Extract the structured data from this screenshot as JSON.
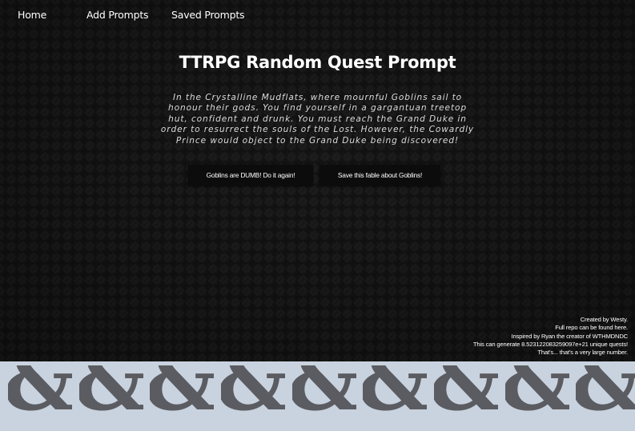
{
  "nav": {
    "home": "Home",
    "add_prompts": "Add Prompts",
    "saved_prompts": "Saved Prompts"
  },
  "title": "TTRPG Random Quest Prompt",
  "quest": "In the Crystalline Mudflats, where mournful Goblins sail to honour their gods. You find yourself in a gargantuan treetop hut, confident and drunk. You must reach the Grand Duke in order to resurrect the souls of the Lost. However, the Cowardly Prince would object to the Grand Duke being discovered!",
  "buttons": {
    "regenerate": "Goblins are DUMB! Do it again!",
    "save": "Save this fable about Goblins!"
  },
  "credits": {
    "created_by": "Created by Westy.",
    "repo": "Full repo can be found here.",
    "inspired": "Inspired by Ryan the creator of WTHMDNDC",
    "generate": "This can generate 8.523122083259097e+21 unique quests!",
    "large": "That's... that's a very large number."
  },
  "footer": {
    "logo_icon": "dnd-ampersand-icon",
    "logo_char": "&",
    "logo_color": "#5b5c61",
    "background": "#c9d3df"
  }
}
